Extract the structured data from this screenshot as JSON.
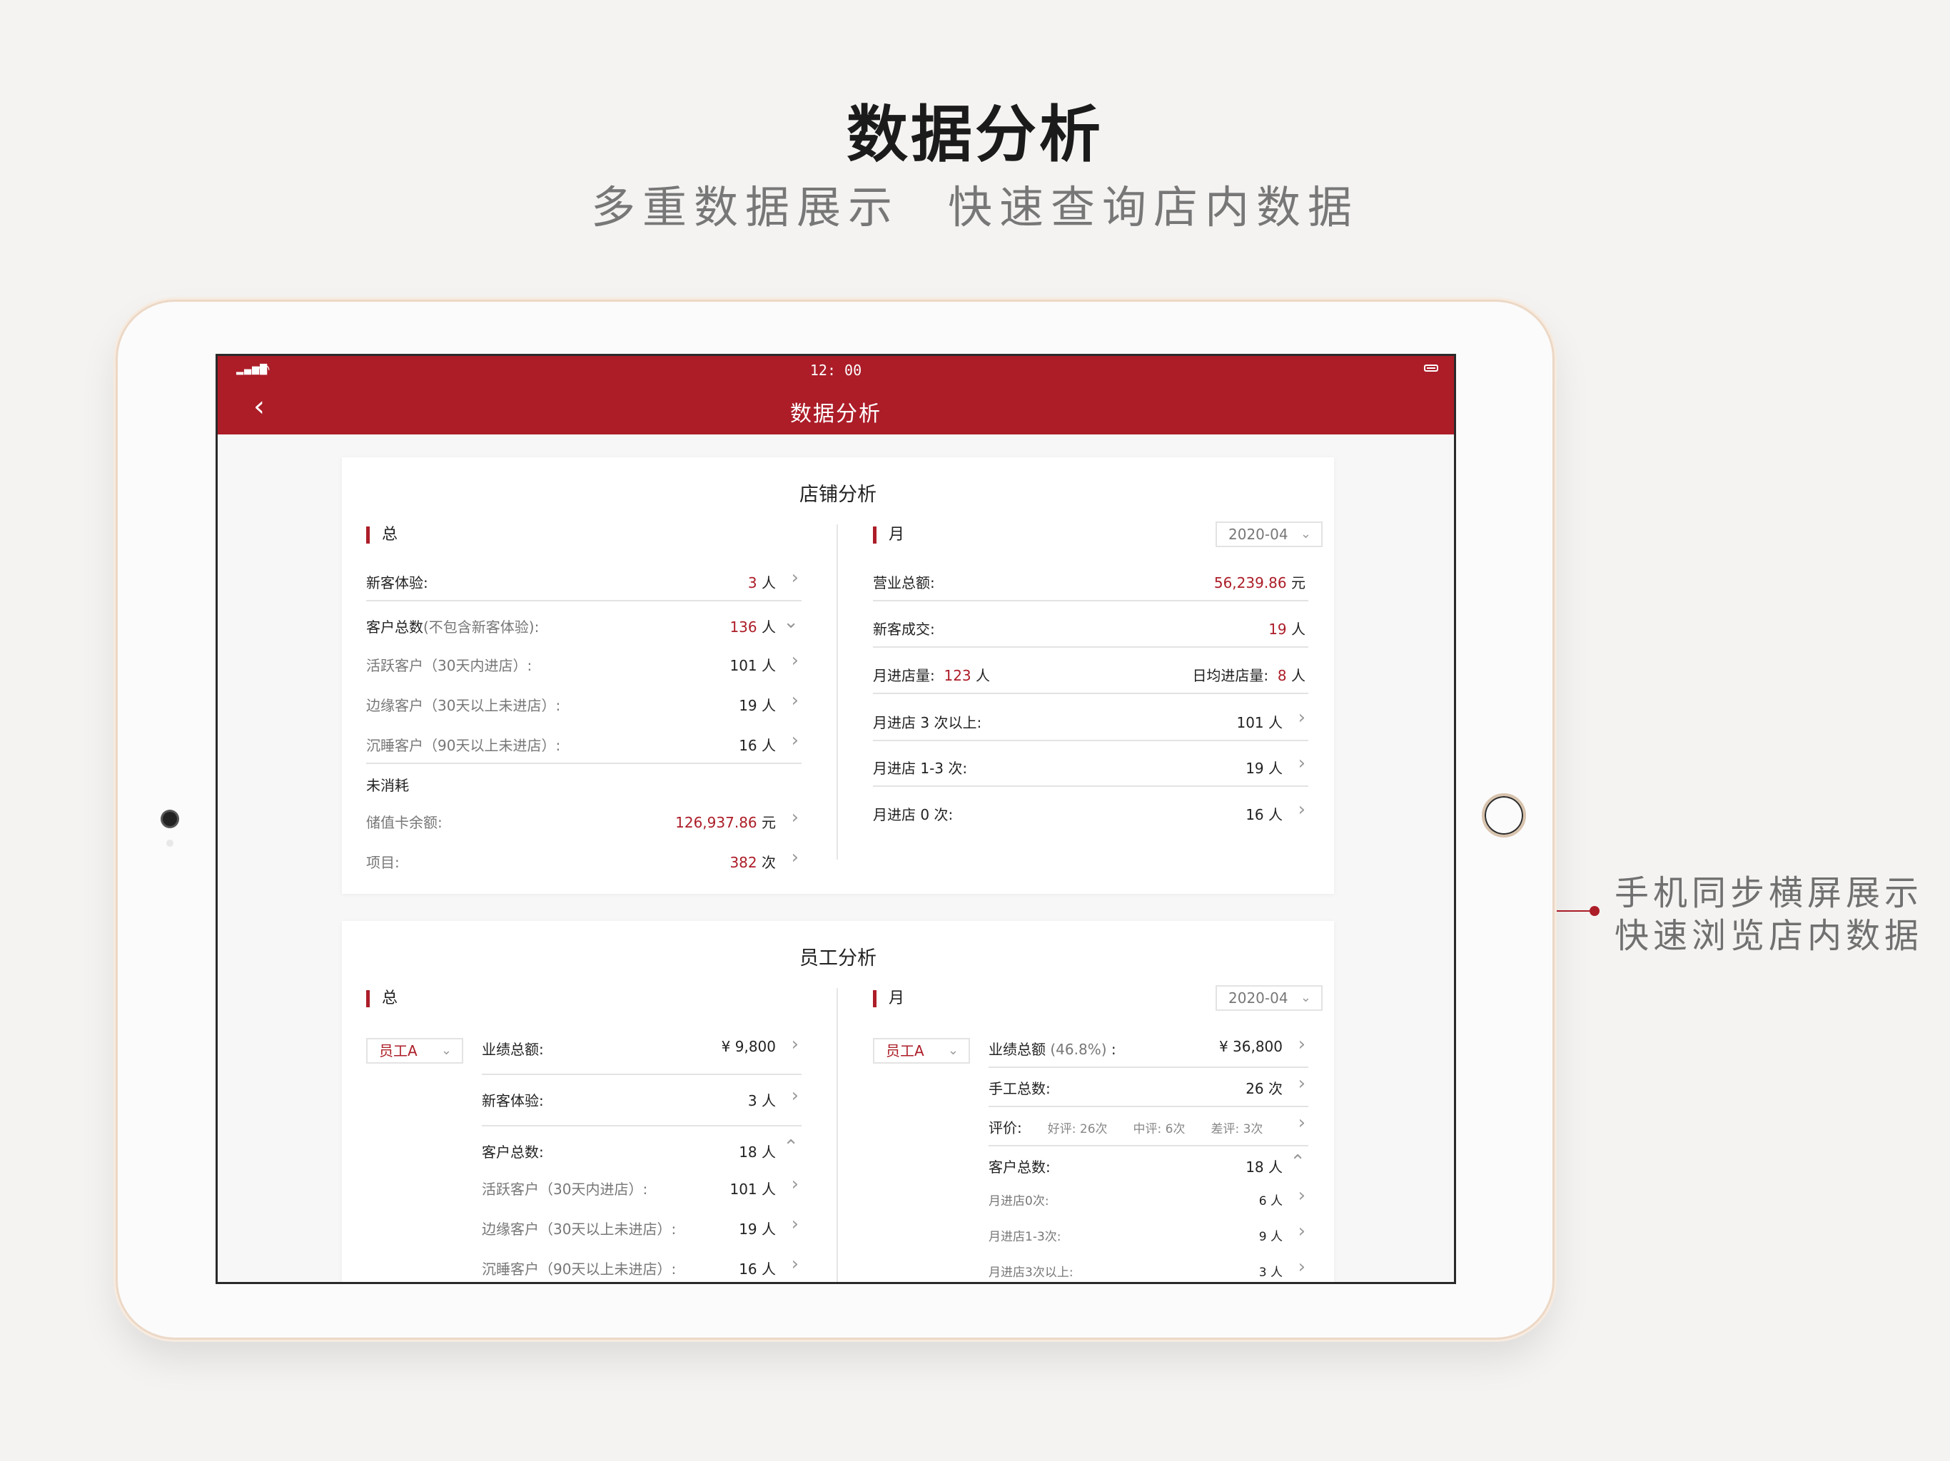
{
  "hero": {
    "title": "数据分析",
    "sub1": "多重数据展示",
    "sub2": "快速查询店内数据"
  },
  "side": {
    "line1": "手机同步横屏展示",
    "line2": "快速浏览店内数据"
  },
  "status": {
    "time": "12: 00"
  },
  "nav": {
    "title": "数据分析",
    "back_icon": "chevron-left-icon"
  },
  "store": {
    "title": "店铺分析",
    "left": {
      "section": "总",
      "new_trial": {
        "label": "新客体验:",
        "value": "3",
        "unit": "人"
      },
      "total_customers": {
        "label": "客户总数",
        "hint": "(不包含新客体验):",
        "value": "136",
        "unit": "人"
      },
      "active": {
        "label": "活跃客户（30天内进店）:",
        "value": "101 人"
      },
      "edge": {
        "label": "边缘客户（30天以上未进店）:",
        "value": "19 人"
      },
      "dormant": {
        "label": "沉睡客户（90天以上未进店）:",
        "value": "16 人"
      },
      "unconsumed": "未消耗",
      "card_balance": {
        "label": "储值卡余额:",
        "value": "126,937.86",
        "unit": "元"
      },
      "items": {
        "label": "项目:",
        "value": "382",
        "unit": "次"
      }
    },
    "right": {
      "section": "月",
      "month": "2020-04",
      "revenue": {
        "label": "营业总额:",
        "value": "56,239.86",
        "unit": "元"
      },
      "new_deal": {
        "label": "新客成交:",
        "value": "19",
        "unit": "人"
      },
      "monthly_visits": {
        "label": "月进店量:",
        "value": "123",
        "unit": "人"
      },
      "daily_visits": {
        "label": "日均进店量:",
        "value": "8",
        "unit": "人"
      },
      "visits3": {
        "label": "月进店 3 次以上:",
        "value": "101 人"
      },
      "visits13": {
        "label": "月进店 1-3 次:",
        "value": "19 人"
      },
      "visits0": {
        "label": "月进店 0 次:",
        "value": "16 人"
      }
    }
  },
  "staff": {
    "title": "员工分析",
    "left": {
      "section": "总",
      "employee": "员工A",
      "performance": {
        "label": "业绩总额:",
        "value": "¥ 9,800"
      },
      "new_trial": {
        "label": "新客体验:",
        "value": "3 人"
      },
      "customers": {
        "label": "客户总数:",
        "value": "18 人"
      },
      "active": {
        "label": "活跃客户（30天内进店）:",
        "value": "101 人"
      },
      "edge": {
        "label": "边缘客户（30天以上未进店）:",
        "value": "19 人"
      },
      "dormant": {
        "label": "沉睡客户（90天以上未进店）:",
        "value": "16 人"
      }
    },
    "right": {
      "section": "月",
      "month": "2020-04",
      "employee": "员工A",
      "performance": {
        "label": "业绩总额",
        "hint": "(46.8%)",
        "suffix": ":",
        "value": "¥ 36,800"
      },
      "manual": {
        "label": "手工总数:",
        "value": "26 次"
      },
      "rating": {
        "label": "评价:",
        "good": "好评: 26次",
        "mid": "中评: 6次",
        "bad": "差评: 3次"
      },
      "customers": {
        "label": "客户总数:",
        "value": "18 人"
      },
      "v0": {
        "label": "月进店0次:",
        "value": "6 人"
      },
      "v13": {
        "label": "月进店1-3次:",
        "value": "9 人"
      },
      "v3": {
        "label": "月进店3次以上:",
        "value": "3 人"
      }
    }
  },
  "colors": {
    "accent": "#ac1d28",
    "background": "#f4f3f1"
  }
}
